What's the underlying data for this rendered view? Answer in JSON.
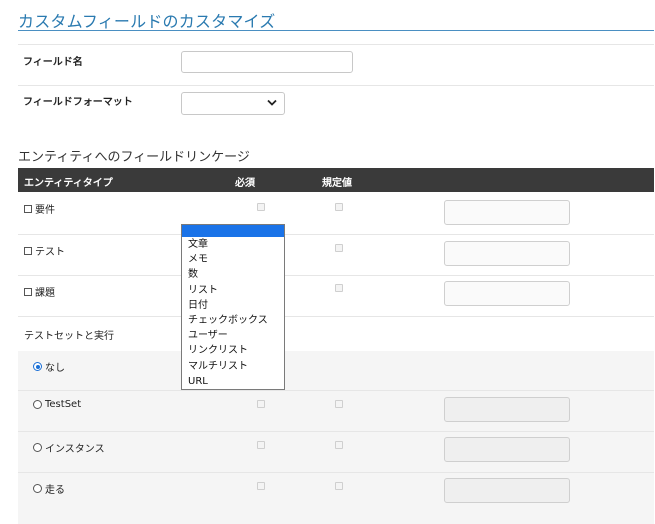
{
  "page": {
    "title": "カスタムフィールドのカスタマイズ"
  },
  "form": {
    "field_name_label": "フィールド名",
    "field_name_value": "",
    "field_format_label": "フィールドフォーマット",
    "field_format_value": ""
  },
  "linkage": {
    "section_title": "エンティティへのフィールドリンケージ",
    "headers": {
      "entity_type": "エンティティタイプ",
      "required": "必須",
      "default": "規定値"
    },
    "rows": [
      {
        "label": "要件",
        "required": false,
        "default": false,
        "default_value": ""
      },
      {
        "label": "テスト",
        "required": false,
        "default": false,
        "default_value": ""
      },
      {
        "label": "課題",
        "required": false,
        "default": false,
        "default_value": ""
      }
    ],
    "testset_heading": "テストセットと実行",
    "testset_rows": [
      {
        "label": "なし",
        "selected": true
      },
      {
        "label": "TestSet",
        "selected": false,
        "default_value": ""
      },
      {
        "label": "インスタンス",
        "selected": false,
        "default_value": ""
      },
      {
        "label": "走る",
        "selected": false,
        "default_value": ""
      }
    ]
  },
  "format_dropdown": {
    "selected_index": 0,
    "options": [
      "",
      "文章",
      "メモ",
      "数",
      "リスト",
      "日付",
      "チェックボックス",
      "ユーザー",
      "リンクリスト",
      "マルチリスト",
      "URL"
    ]
  }
}
